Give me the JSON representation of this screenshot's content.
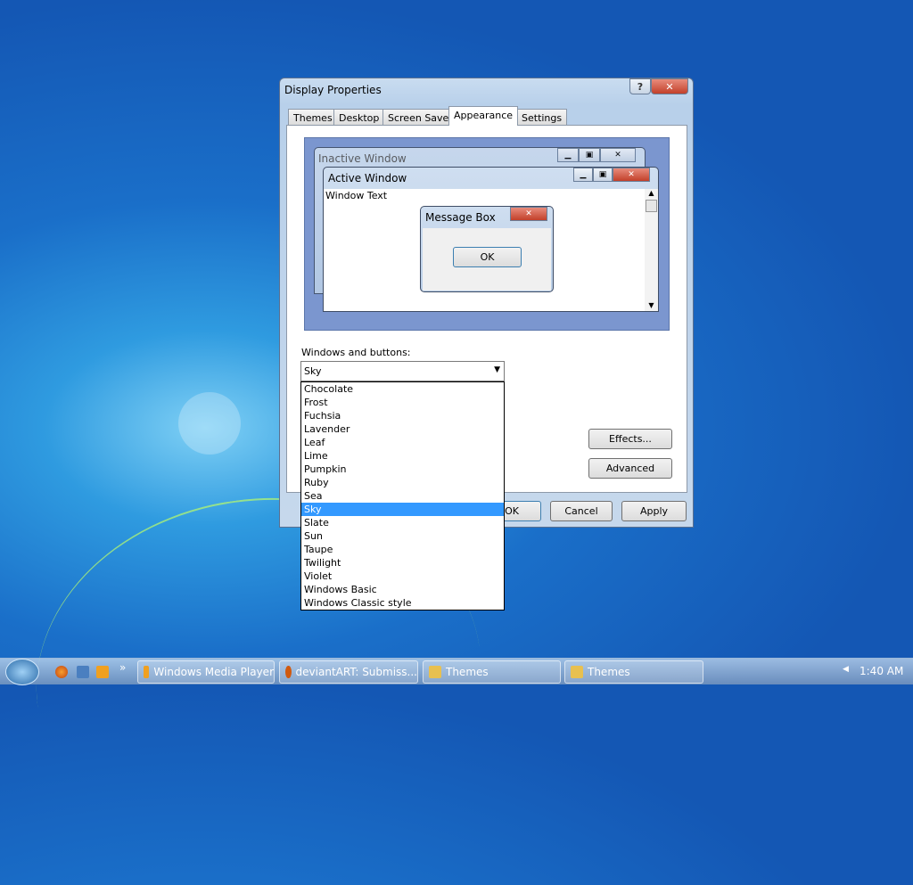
{
  "dialog": {
    "title": "Display Properties",
    "help": "?",
    "close": "✕",
    "tabs": [
      "Themes",
      "Desktop",
      "Screen Saver",
      "Appearance",
      "Settings"
    ],
    "active_tab": "Appearance",
    "preview": {
      "inactive_title": "Inactive Window",
      "active_title": "Active Window",
      "window_text": "Window Text",
      "message_title": "Message Box",
      "ok": "OK"
    },
    "windows_buttons_label": "Windows and buttons:",
    "selected": "Sky",
    "options": [
      "Chocolate",
      "Frost",
      "Fuchsia",
      "Lavender",
      "Leaf",
      "Lime",
      "Pumpkin",
      "Ruby",
      "Sea",
      "Sky",
      "Slate",
      "Sun",
      "Taupe",
      "Twilight",
      "Violet",
      "Windows Basic",
      "Windows Classic style"
    ],
    "effects": "Effects...",
    "advanced": "Advanced",
    "ok": "OK",
    "cancel": "Cancel",
    "apply": "Apply"
  },
  "taskbar": {
    "items": [
      "Windows Media Player",
      "deviantART: Submiss...",
      "Themes",
      "Themes"
    ],
    "overflow": "»",
    "clock": "1:40 AM"
  }
}
